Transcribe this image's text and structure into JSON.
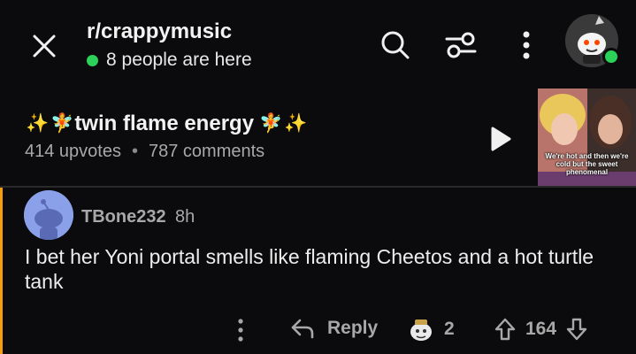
{
  "header": {
    "subreddit": "r/crappymusic",
    "presence_text": "8 people are here"
  },
  "post": {
    "title": "twin flame energy",
    "title_emojis": [
      "✨",
      "🧚",
      "🧚",
      "✨"
    ],
    "upvotes_text": "414 upvotes",
    "separator": "•",
    "comments_text": "787 comments",
    "thumbnail_caption": "We're hot and then we're cold but the sweet phenomenal"
  },
  "comment": {
    "username": "TBone232",
    "time": "8h",
    "body": "I bet her Yoni portal smells like flaming Cheetos and a hot turtle tank"
  },
  "actions": {
    "reply_label": "Reply",
    "award_count": "2",
    "vote_score": "164"
  },
  "colors": {
    "background": "#0b0b0d",
    "online": "#2bd158",
    "thread_bar": "#f59e0b",
    "muted_text": "#a8a8a8"
  },
  "icons": [
    "close-icon",
    "search-icon",
    "filter-icon",
    "more-vertical-icon",
    "play-icon",
    "reply-arrow-icon",
    "award-icon",
    "upvote-icon",
    "downvote-icon"
  ]
}
